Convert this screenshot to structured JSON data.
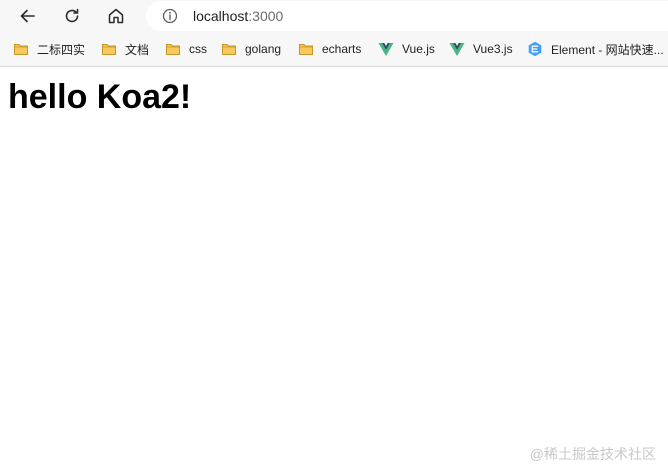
{
  "toolbar": {
    "back_icon": "back-arrow-icon",
    "reload_icon": "reload-icon",
    "home_icon": "home-icon",
    "info_icon": "info-icon",
    "url_host": "localhost",
    "url_port": ":3000"
  },
  "bookmarks": [
    {
      "label": "二标四实",
      "icon": "folder-icon"
    },
    {
      "label": "文档",
      "icon": "folder-icon"
    },
    {
      "label": "css",
      "icon": "folder-icon"
    },
    {
      "label": "golang",
      "icon": "folder-icon"
    },
    {
      "label": "echarts",
      "icon": "folder-icon"
    },
    {
      "label": "Vue.js",
      "icon": "vue-logo-icon"
    },
    {
      "label": "Vue3.js",
      "icon": "vue-logo-icon"
    },
    {
      "label": "Element - 网站快速...",
      "icon": "element-logo-icon"
    }
  ],
  "page": {
    "heading": "hello Koa2!"
  },
  "watermark": "@稀土掘金技术社区",
  "colors": {
    "toolbar_bg": "#f7f7f7",
    "folder_fill": "#f5c95a",
    "folder_stroke": "#c9962a",
    "vue_green": "#41b883",
    "vue_dark": "#35495e",
    "element_blue": "#409eff"
  }
}
